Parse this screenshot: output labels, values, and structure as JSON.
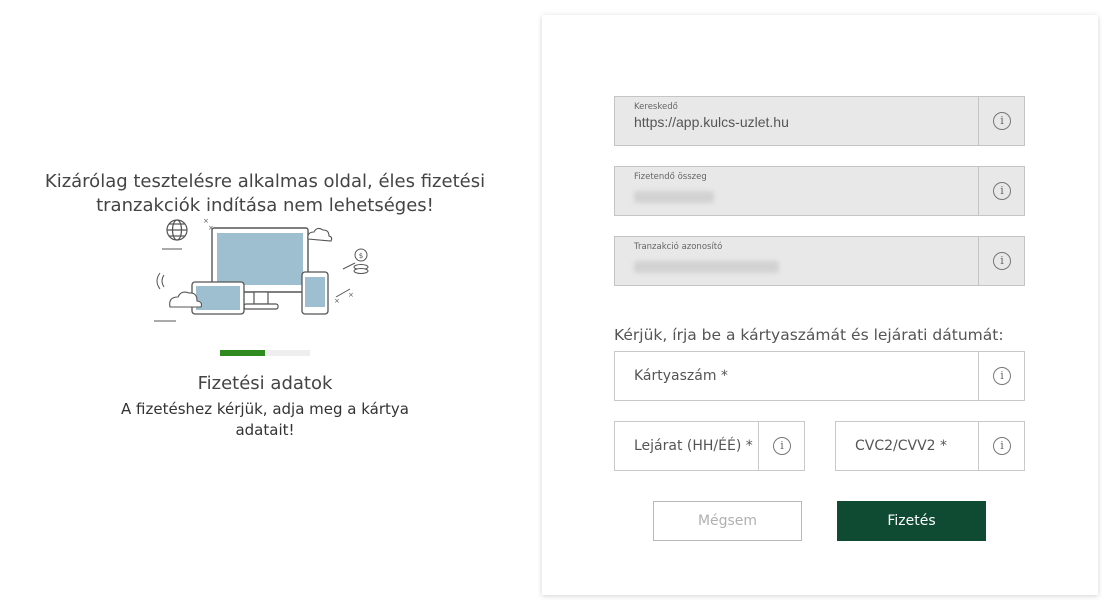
{
  "left": {
    "notice": "Kizárólag tesztelésre alkalmas oldal, éles fizetési tranzakciók indítása nem lehetséges!",
    "progress": 0.5,
    "step_title": "Fizetési adatok",
    "step_desc": "A fizetéshez kérjük, adja meg a kártya adatait!"
  },
  "form": {
    "merchant": {
      "label": "Kereskedő",
      "value": "https://app.kulcs-uzlet.hu"
    },
    "amount": {
      "label": "Fizetendő összeg"
    },
    "transaction": {
      "label": "Tranzakció azonosító"
    },
    "prompt": "Kérjük, írja be a kártyaszámát és lejárati dátumát:",
    "card_number": {
      "placeholder": "Kártyaszám *"
    },
    "expiry": {
      "placeholder": "Lejárat (HH/ÉÉ) *"
    },
    "cvc": {
      "placeholder": "CVC2/CVV2 *"
    },
    "info_glyph": "i",
    "cancel_label": "Mégsem",
    "pay_label": "Fizetés"
  },
  "colors": {
    "accent": "#0f4a32",
    "progress": "#2f8a1f"
  }
}
